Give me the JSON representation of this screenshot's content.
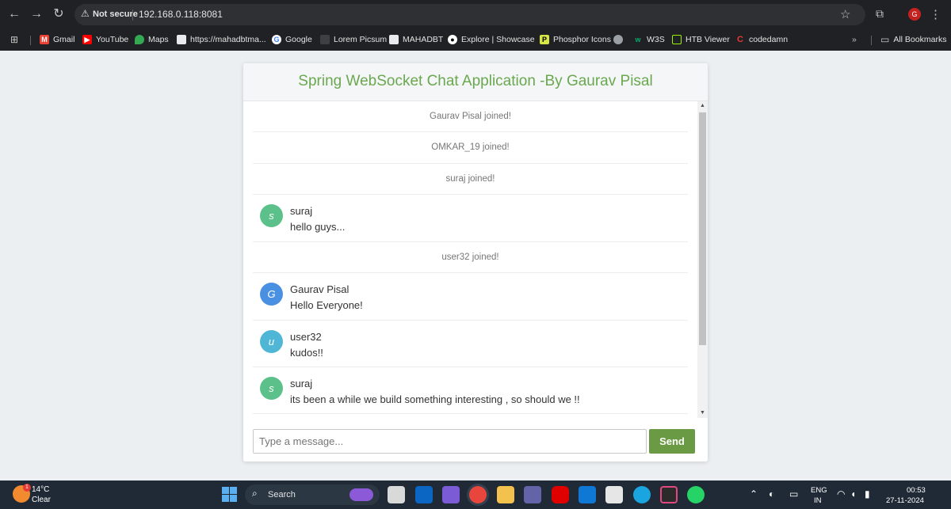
{
  "browser": {
    "security_label": "Not secure",
    "url": "192.168.0.118:8081",
    "profile_initial": "G",
    "bookmarks": [
      {
        "label": "Gmail",
        "color": "#ea4335"
      },
      {
        "label": "YouTube",
        "color": "#ff0000"
      },
      {
        "label": "Maps",
        "color": "#34a853"
      },
      {
        "label": "https://mahadbtma...",
        "color": "#e8eaed"
      },
      {
        "label": "Google",
        "color": "#ffffff"
      },
      {
        "label": "Lorem Picsum",
        "color": "#3c4043"
      },
      {
        "label": "MAHADBT",
        "color": "#e8eaed"
      },
      {
        "label": "Explore | Showcase",
        "color": "#ffffff"
      },
      {
        "label": "Phosphor Icons",
        "color": "#d5e645"
      },
      {
        "label": "",
        "color": "#9aa0a6"
      },
      {
        "label": "W3S",
        "color": "#04aa6d"
      },
      {
        "label": "HTB Viewer",
        "color": "#9fef00"
      },
      {
        "label": "codedamn",
        "color": "#e53935"
      }
    ],
    "all_bookmarks": "All Bookmarks"
  },
  "chat": {
    "title": "Spring WebSocket Chat Application -By Gaurav Pisal",
    "messages": [
      {
        "type": "event",
        "text": "Gaurav Pisal joined!"
      },
      {
        "type": "event",
        "text": "OMKAR_19 joined!"
      },
      {
        "type": "event",
        "text": "suraj joined!"
      },
      {
        "type": "chat",
        "initial": "s",
        "sender": "suraj",
        "text": "hello guys...",
        "color": "#5cc08a"
      },
      {
        "type": "event",
        "text": "user32 joined!"
      },
      {
        "type": "chat",
        "initial": "G",
        "sender": "Gaurav Pisal",
        "text": "Hello Everyone!",
        "color": "#4a90e2"
      },
      {
        "type": "chat",
        "initial": "u",
        "sender": "user32",
        "text": "kudos!!",
        "color": "#4fb6d6"
      },
      {
        "type": "chat",
        "initial": "s",
        "sender": "suraj",
        "text": "its been a while we build something interesting , so should we !!",
        "color": "#5cc08a"
      }
    ],
    "input_placeholder": "Type a message...",
    "send_label": "Send",
    "accent_color": "#6a9a43"
  },
  "taskbar": {
    "temperature": "14°C",
    "condition": "Clear",
    "weather_badge": "1",
    "search_label": "Search",
    "language": "ENG",
    "region": "IN",
    "time": "00:53",
    "date": "27-11-2024"
  }
}
